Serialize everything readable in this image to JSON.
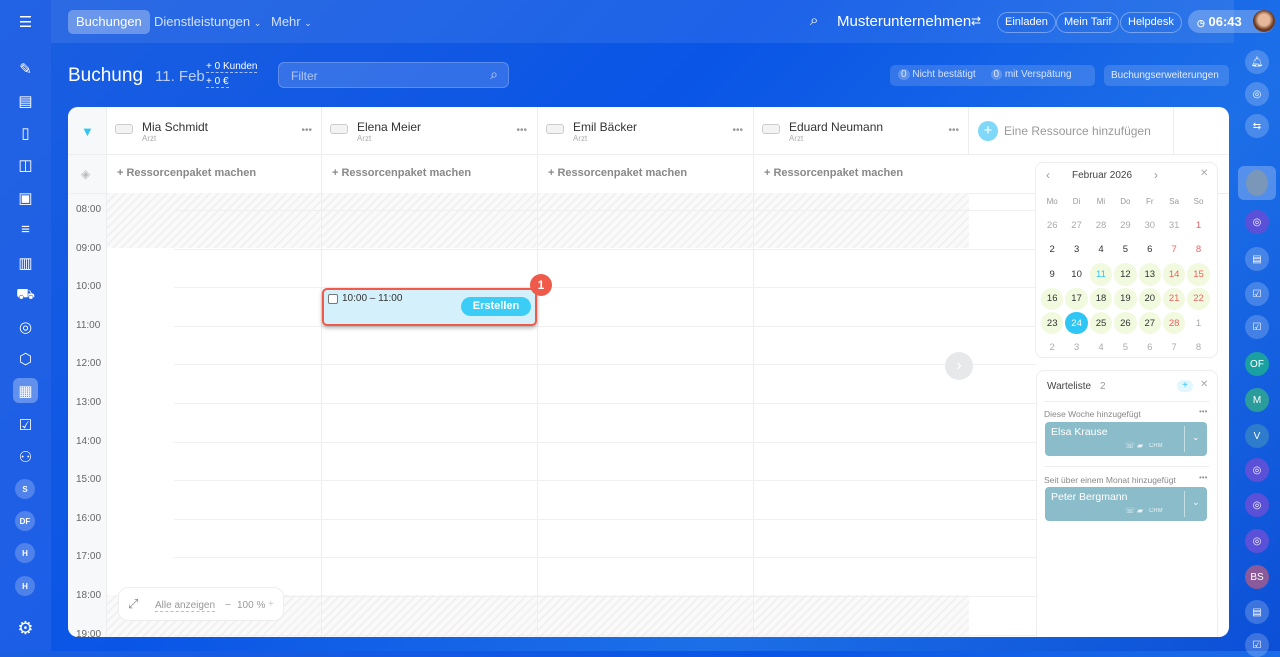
{
  "topbar": {
    "tabs": [
      "Buchungen",
      "Dienstleistungen",
      "Mehr"
    ],
    "company": "Musterunternehmen",
    "buttons": [
      "Einladen",
      "Mein Tarif",
      "Helpdesk"
    ],
    "clock": "06:43"
  },
  "header": {
    "title": "Buchung",
    "date": "11. Feb",
    "clients": "+ 0 Kunden",
    "revenue": "+ 0 €",
    "filter_placeholder": "Filter",
    "unconfirmed_count": "0",
    "unconfirmed_label": "Nicht bestätigt",
    "late_count": "0",
    "late_label": "mit Verspätung",
    "extensions": "Buchungserweiterungen"
  },
  "left_sidebar": {
    "avatars": [
      "S",
      "DF",
      "H",
      "H"
    ]
  },
  "right_sidebar": {
    "avatars": [
      "OF",
      "M",
      "V",
      "BS"
    ]
  },
  "resources": [
    {
      "name": "Mia Schmidt",
      "role": "Arzt"
    },
    {
      "name": "Elena Meier",
      "role": "Arzt"
    },
    {
      "name": "Emil Bäcker",
      "role": "Arzt"
    },
    {
      "name": "Eduard Neumann",
      "role": "Arzt"
    }
  ],
  "add_resource": "Eine Ressource hinzufügen",
  "package_label": "+ Ressorcenpaket machen",
  "hours": [
    "08:00",
    "09:00",
    "10:00",
    "11:00",
    "12:00",
    "13:00",
    "14:00",
    "15:00",
    "16:00",
    "17:00",
    "18:00",
    "19:00"
  ],
  "slot": {
    "time": "10:00 – 11:00",
    "button": "Erstellen",
    "badge": "1"
  },
  "zoom_toolbar": {
    "show_all": "Alle anzeigen",
    "minus": "−",
    "level": "100 %",
    "plus": "+"
  },
  "calendar": {
    "month": "Februar 2026",
    "weekdays": [
      "Mo",
      "Di",
      "Mi",
      "Do",
      "Fr",
      "Sa",
      "So"
    ],
    "days": [
      "26",
      "27",
      "28",
      "29",
      "30",
      "31",
      "1",
      "2",
      "3",
      "4",
      "5",
      "6",
      "7",
      "8",
      "9",
      "10",
      "11",
      "12",
      "13",
      "14",
      "15",
      "16",
      "17",
      "18",
      "19",
      "20",
      "21",
      "22",
      "23",
      "24",
      "25",
      "26",
      "27",
      "28",
      "1",
      "2",
      "3",
      "4",
      "5",
      "6",
      "7",
      "8"
    ],
    "selected": "24"
  },
  "waitlist": {
    "title": "Warteliste",
    "count": "2",
    "groups": [
      {
        "label": "Diese Woche hinzugefügt",
        "name": "Elsa Krause",
        "crm": "CRM"
      },
      {
        "label": "Seit über einem Monat hinzugefügt",
        "name": "Peter Bergmann",
        "crm": "CRM"
      }
    ]
  }
}
